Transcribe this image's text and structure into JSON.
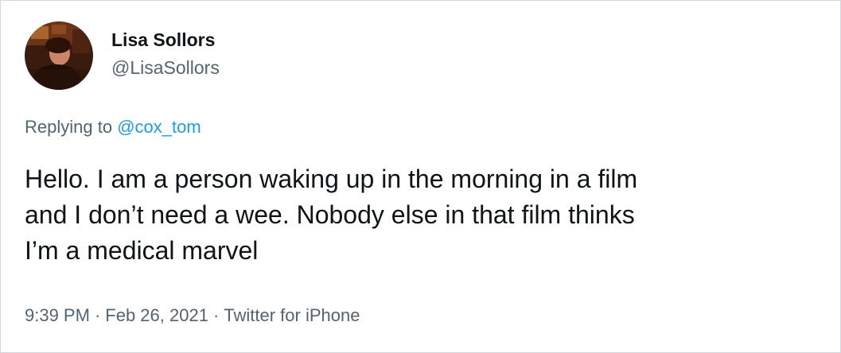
{
  "author": {
    "display_name": "Lisa Sollors",
    "handle": "@LisaSollors"
  },
  "reply": {
    "prefix": "Replying to",
    "mention": "@cox_tom"
  },
  "tweet": {
    "lines": [
      "Hello. I am a person waking up in the morning in a film",
      "and I don’t need a wee. Nobody else in that film thinks",
      "I’m a medical marvel"
    ]
  },
  "meta": {
    "time": "9:39 PM",
    "separator": "·",
    "date": "Feb 26, 2021",
    "source": "Twitter for iPhone"
  },
  "colors": {
    "text": "#0f1419",
    "secondary": "#536471",
    "link": "#1d9bf0",
    "border": "#cfd9de"
  }
}
